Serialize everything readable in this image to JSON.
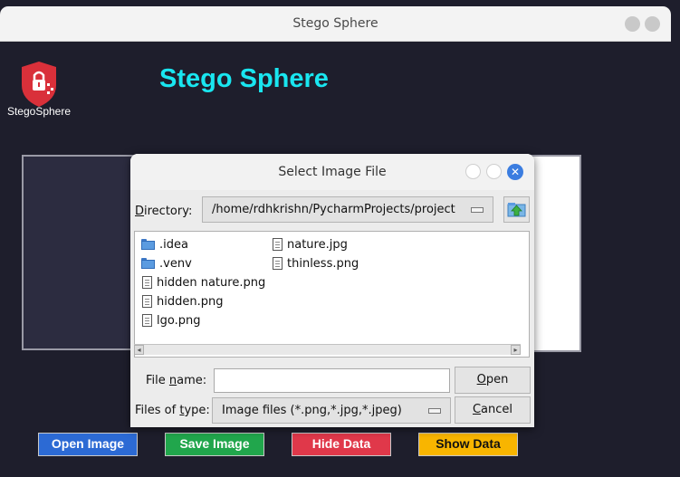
{
  "window": {
    "title": "Stego Sphere"
  },
  "app": {
    "logo_text": "StegoSphere",
    "title": "Stego Sphere",
    "buttons": [
      {
        "label": "Open Image",
        "bg": "#2c6ad4",
        "fg": "#ffffff"
      },
      {
        "label": "Save Image",
        "bg": "#21a64c",
        "fg": "#ffffff"
      },
      {
        "label": "Hide Data",
        "bg": "#e0384a",
        "fg": "#ffffff"
      },
      {
        "label": "Show Data",
        "bg": "#f8b500",
        "fg": "#111111"
      }
    ],
    "colors": {
      "title": "#19e6f0",
      "background": "#1e1e2c",
      "accent": "#d9303a"
    }
  },
  "dialog": {
    "title": "Select Image File",
    "directory_label_pre": "D",
    "directory_label_post": "irectory:",
    "directory_value": "/home/rdhkrishn/PycharmProjects/project",
    "files": [
      {
        "name": ".idea",
        "icon": "folder-icon"
      },
      {
        "name": ".venv",
        "icon": "folder-icon"
      },
      {
        "name": "hidden nature.png",
        "icon": "file-icon"
      },
      {
        "name": "hidden.png",
        "icon": "file-icon"
      },
      {
        "name": "lgo.png",
        "icon": "file-icon"
      },
      {
        "name": "nature.jpg",
        "icon": "file-icon"
      },
      {
        "name": "thinless.png",
        "icon": "file-icon"
      }
    ],
    "filename_label_pre": "File ",
    "filename_label_u": "n",
    "filename_label_post": "ame:",
    "filename_value": "",
    "filetype_label_pre": "Files of ",
    "filetype_label_u": "t",
    "filetype_label_post": "ype:",
    "filetype_value": "Image files (*.png,*.jpg,*.jpeg)",
    "open_u": "O",
    "open_rest": "pen",
    "cancel_u": "C",
    "cancel_rest": "ancel"
  }
}
